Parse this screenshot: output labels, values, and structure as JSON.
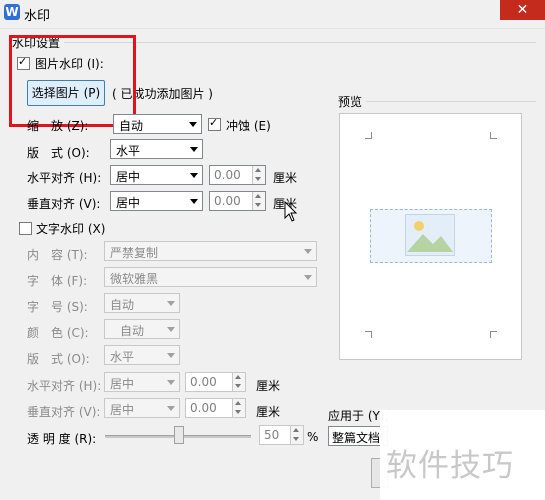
{
  "window": {
    "title": "水印",
    "close_label": "✕"
  },
  "section_title": "水印设置",
  "picture": {
    "checkbox_label": "图片水印 (I):",
    "select_button": "选择图片 (P)",
    "status": "( 已成功添加图片 )",
    "scale_label": "缩　放 (Z):",
    "scale_value": "自动",
    "washout_label": "冲蚀 (E)",
    "layout_label": "版　式 (O):",
    "layout_value": "水平",
    "halign_label": "水平对齐 (H):",
    "halign_value": "居中",
    "halign_offset": "0.00",
    "valign_label": "垂直对齐 (V):",
    "valign_value": "居中",
    "valign_offset": "0.00",
    "unit": "厘米"
  },
  "text": {
    "checkbox_label": "文字水印 (X)",
    "content_label": "内　容 (T):",
    "content_value": "严禁复制",
    "font_label": "字　体 (F):",
    "font_value": "微软雅黑",
    "size_label": "字　号 (S):",
    "size_value": "自动",
    "color_label": "颜　色 (C):",
    "color_value": "自动",
    "layout_label": "版　式 (O):",
    "layout_value": "水平",
    "halign_label": "水平对齐 (H):",
    "halign_value": "居中",
    "halign_offset": "0.00",
    "valign_label": "垂直对齐 (V):",
    "valign_value": "居中",
    "valign_offset": "0.00",
    "unit": "厘米",
    "transparency_label": "透 明 度 (R):",
    "transparency_value": "50",
    "transparency_unit": "%"
  },
  "preview": {
    "label": "预览"
  },
  "apply_to": {
    "label": "应用于 (Y):",
    "value": "整篇文档"
  },
  "watermark_overlay": "软件技巧",
  "colors": {
    "highlight": "#e0141a",
    "accent": "#2f6fd6"
  }
}
